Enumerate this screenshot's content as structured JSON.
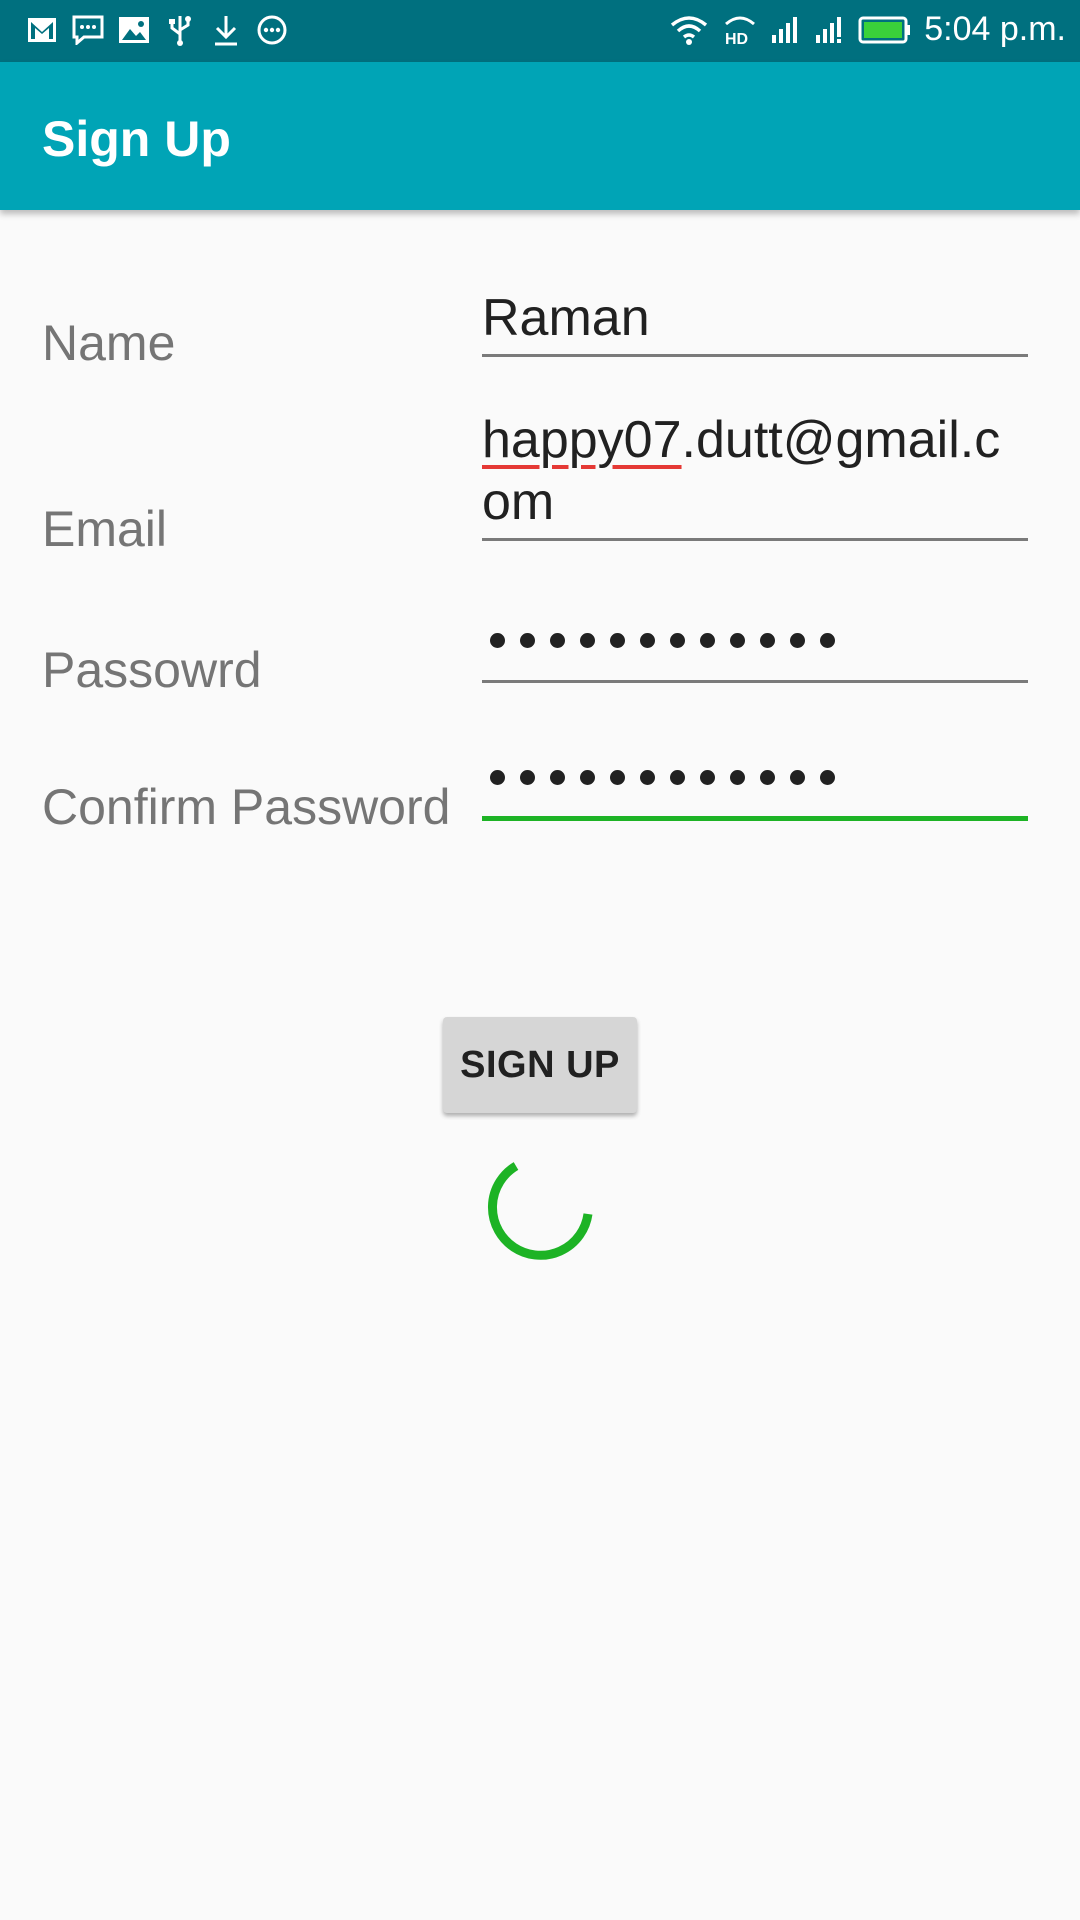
{
  "status_bar": {
    "time": "5:04 p.m.",
    "left_icons": [
      "gmail-icon",
      "message-icon",
      "image-icon",
      "usb-icon",
      "download-icon",
      "more-icon"
    ],
    "right_icons": [
      "wifi-icon",
      "hd-call-icon",
      "signal-icon",
      "signal-icon",
      "battery-icon"
    ]
  },
  "app_bar": {
    "title": "Sign Up"
  },
  "form": {
    "name": {
      "label": "Name",
      "value": "Raman"
    },
    "email": {
      "label": "Email",
      "value_underlined": "happy07",
      "value_rest_line1": ".dutt@gmail.c",
      "value_line2": "om"
    },
    "password": {
      "label": "Passowrd",
      "masked_length": 12
    },
    "confirm_password": {
      "label": "Confirm Password",
      "masked_length": 12
    }
  },
  "signup_button": {
    "label": "SIGN UP"
  },
  "colors": {
    "status_bar": "#00707f",
    "app_bar": "#00a4b6",
    "focus_accent": "#1db325",
    "spell_error": "#e53935"
  }
}
